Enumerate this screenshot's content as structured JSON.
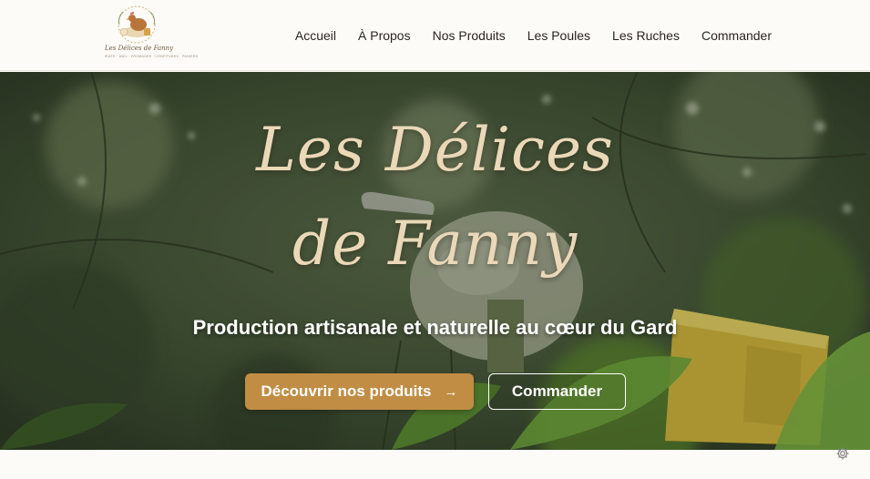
{
  "header": {
    "logo": {
      "brand": "Les Délices de Fanny",
      "tagline": "ŒUFS · MIEL · FROMAGES · CONFITURES · PANIERS"
    },
    "nav": [
      {
        "label": "Accueil"
      },
      {
        "label": "À Propos"
      },
      {
        "label": "Nos Produits"
      },
      {
        "label": "Les Poules"
      },
      {
        "label": "Les Ruches"
      },
      {
        "label": "Commander"
      }
    ]
  },
  "hero": {
    "title_line1": "Les Délices",
    "title_line2": "de Fanny",
    "subtitle": "Production artisanale et naturelle au cœur du Gard",
    "primary_button": {
      "label": "Découvrir nos produits",
      "icon": "arrow-right-icon"
    },
    "secondary_button": {
      "label": "Commander"
    }
  },
  "colors": {
    "accent": "#c18d44",
    "title": "#ead8b8",
    "background": "#fcfbf8",
    "nav_text": "#2a2520"
  },
  "corner_icon": "gear-icon"
}
